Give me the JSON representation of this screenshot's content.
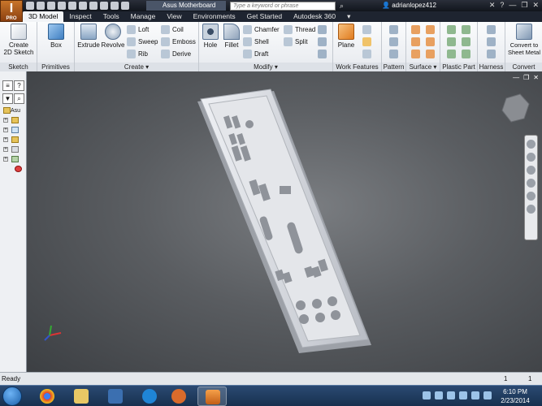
{
  "app": {
    "badge": "I",
    "badge_sub": "PRO"
  },
  "titlebar": {
    "document": "Asus Motherboard",
    "search_placeholder": "Type a keyword or phrase",
    "user": "adrianlopez412"
  },
  "tabs": [
    "3D Model",
    "Inspect",
    "Tools",
    "Manage",
    "View",
    "Environments",
    "Get Started",
    "Autodesk 360"
  ],
  "ribbon": {
    "sketch": {
      "title": "Sketch",
      "create_2d": "Create\n2D Sketch"
    },
    "primitives": {
      "title": "Primitives",
      "box": "Box"
    },
    "create": {
      "title": "Create ▾",
      "extrude": "Extrude",
      "revolve": "Revolve",
      "loft": "Loft",
      "sweep": "Sweep",
      "rib": "Rib",
      "coil": "Coil",
      "emboss": "Emboss",
      "derive": "Derive"
    },
    "modify": {
      "title": "Modify ▾",
      "hole": "Hole",
      "fillet": "Fillet",
      "chamfer": "Chamfer",
      "shell": "Shell",
      "draft": "Draft",
      "thread": "Thread",
      "split": "Split"
    },
    "work": {
      "title": "Work Features",
      "plane": "Plane"
    },
    "pattern": {
      "title": "Pattern"
    },
    "surface": {
      "title": "Surface ▾"
    },
    "plastic": {
      "title": "Plastic Part"
    },
    "harness": {
      "title": "Harness"
    },
    "convert": {
      "title": "Convert",
      "sheet_metal": "Convert to\nSheet Metal"
    }
  },
  "browser": {
    "root_label": "Asu"
  },
  "status": {
    "text": "Ready",
    "num1": "1",
    "num2": "1"
  },
  "clock": {
    "time": "6:10 PM",
    "date": "2/23/2014"
  },
  "colors": {
    "accent": "#c9762b",
    "viewport": "#5a5d61",
    "part": "#c9ccd3"
  }
}
